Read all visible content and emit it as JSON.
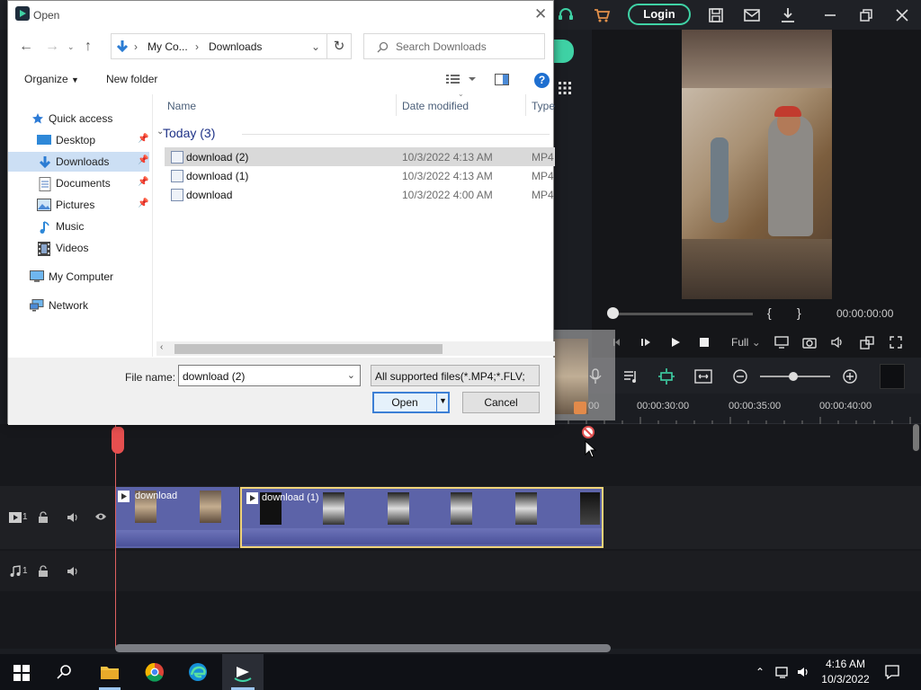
{
  "editor": {
    "login_label": "Login",
    "timecode": "00:00:00:00",
    "zoom_select": "Full",
    "brace_open": "{",
    "brace_close": "}",
    "ruler": [
      "00",
      "00:00:30:00",
      "00:00:35:00",
      "00:00:40:00"
    ],
    "clips": [
      {
        "title": "download"
      },
      {
        "title": "download (1)"
      }
    ],
    "track_video_num": "1",
    "track_audio_num": "1",
    "accent": "#3fd2a5",
    "clip_color": "#5c63a8",
    "selected_clip_border": "#f1d47a",
    "playhead_color": "#e54f4f"
  },
  "dialog": {
    "title": "Open",
    "breadcrumb": [
      "My Co...",
      "Downloads"
    ],
    "search_placeholder": "Search Downloads",
    "organize_label": "Organize",
    "new_folder_label": "New folder",
    "sidebar": [
      {
        "label": "Quick access",
        "icon": "star-icon"
      },
      {
        "label": "Desktop",
        "icon": "desktop-icon",
        "pinned": true
      },
      {
        "label": "Downloads",
        "icon": "download-arrow-icon",
        "pinned": true,
        "selected": true
      },
      {
        "label": "Documents",
        "icon": "documents-icon",
        "pinned": true
      },
      {
        "label": "Pictures",
        "icon": "pictures-icon",
        "pinned": true
      },
      {
        "label": "Music",
        "icon": "music-icon"
      },
      {
        "label": "Videos",
        "icon": "videos-icon"
      },
      {
        "label": "My Computer",
        "icon": "computer-icon"
      },
      {
        "label": "Network",
        "icon": "network-icon"
      }
    ],
    "columns": {
      "name": "Name",
      "date": "Date modified",
      "type": "Type"
    },
    "group_label": "Today (3)",
    "files": [
      {
        "name": "download (2)",
        "date": "10/3/2022 4:13 AM",
        "type": "MP4",
        "selected": true
      },
      {
        "name": "download (1)",
        "date": "10/3/2022 4:13 AM",
        "type": "MP4"
      },
      {
        "name": "download",
        "date": "10/3/2022 4:00 AM",
        "type": "MP4"
      }
    ],
    "file_name_label": "File name:",
    "file_name_value": "download (2)",
    "filter_value": "All supported files(*.MP4;*.FLV;",
    "open_label": "Open",
    "cancel_label": "Cancel"
  },
  "taskbar": {
    "time": "4:16 AM",
    "date": "10/3/2022"
  }
}
